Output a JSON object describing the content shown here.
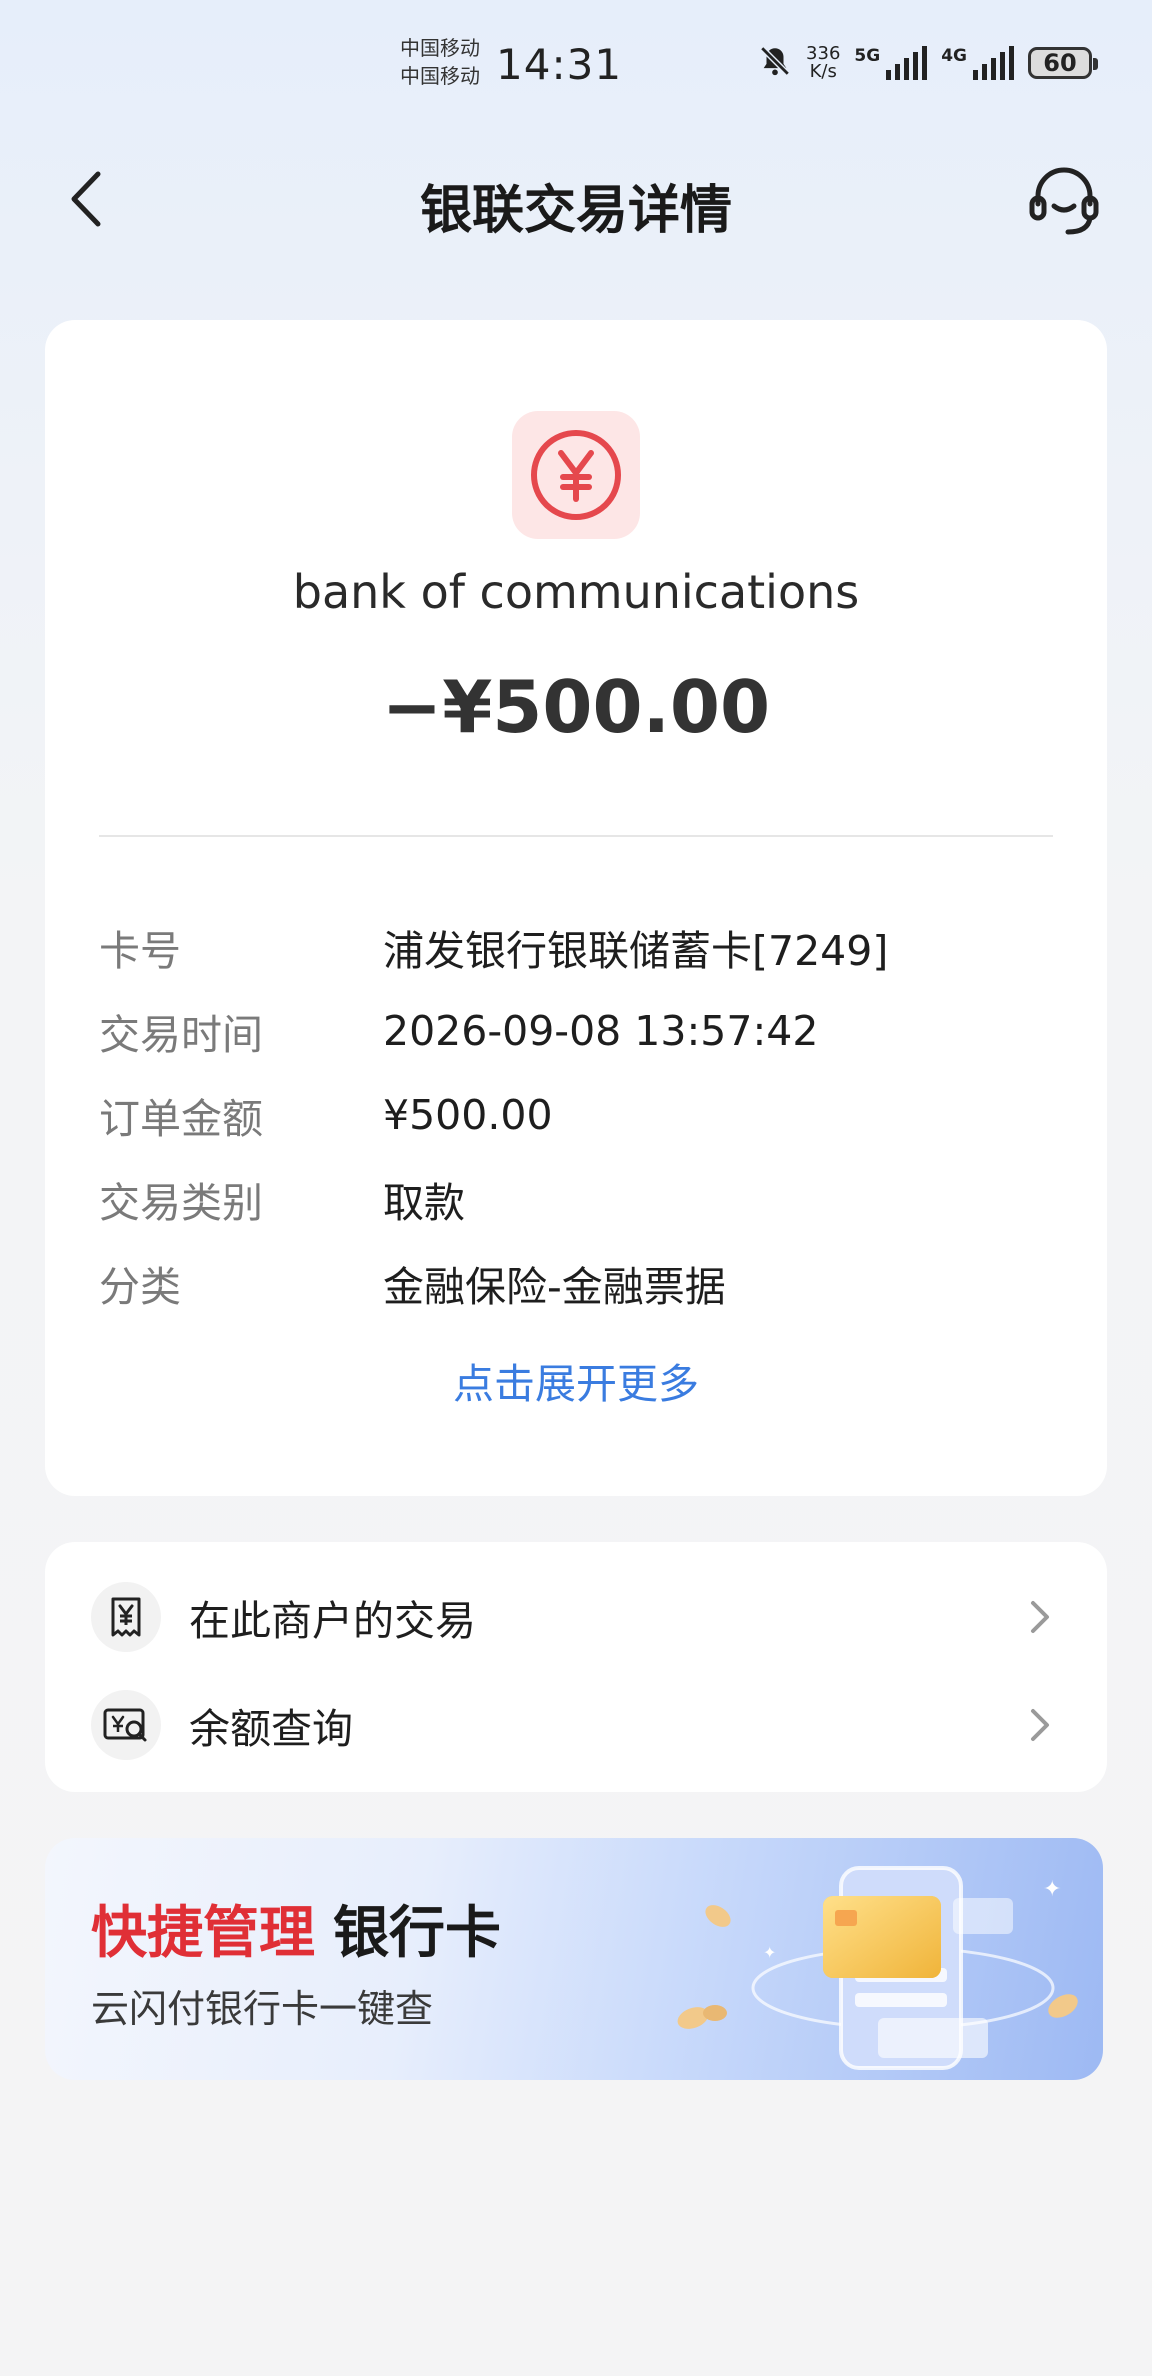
{
  "status_bar": {
    "carrier_1": "中国移动",
    "carrier_2": "中国移动",
    "time": "14:31",
    "net_speed_value": "336",
    "net_speed_unit": "K/s",
    "signal_1_label": "5G",
    "signal_2_label": "4G",
    "battery": "60"
  },
  "nav": {
    "title": "银联交易详情"
  },
  "transaction": {
    "merchant_name": "bank of communications",
    "amount": "−¥500.00",
    "details": [
      {
        "label": "卡号",
        "value": "浦发银行银联储蓄卡[7249]"
      },
      {
        "label": "交易时间",
        "value": "2026-09-08 13:57:42"
      },
      {
        "label": "订单金额",
        "value": "¥500.00"
      },
      {
        "label": "交易类别",
        "value": "取款"
      },
      {
        "label": "分类",
        "value": "金融保险-金融票据"
      }
    ],
    "expand_label": "点击展开更多"
  },
  "menu": {
    "items": [
      {
        "label": "在此商户的交易",
        "icon": "receipt-yen-icon"
      },
      {
        "label": "余额查询",
        "icon": "balance-search-icon"
      }
    ]
  },
  "banner": {
    "title_highlight": "快捷管理",
    "title_rest": "银行卡",
    "subtitle": "云闪付银行卡一键查"
  },
  "colors": {
    "accent_red": "#e02f36",
    "link_blue": "#3a7ce0",
    "icon_red": "#e5484d"
  }
}
